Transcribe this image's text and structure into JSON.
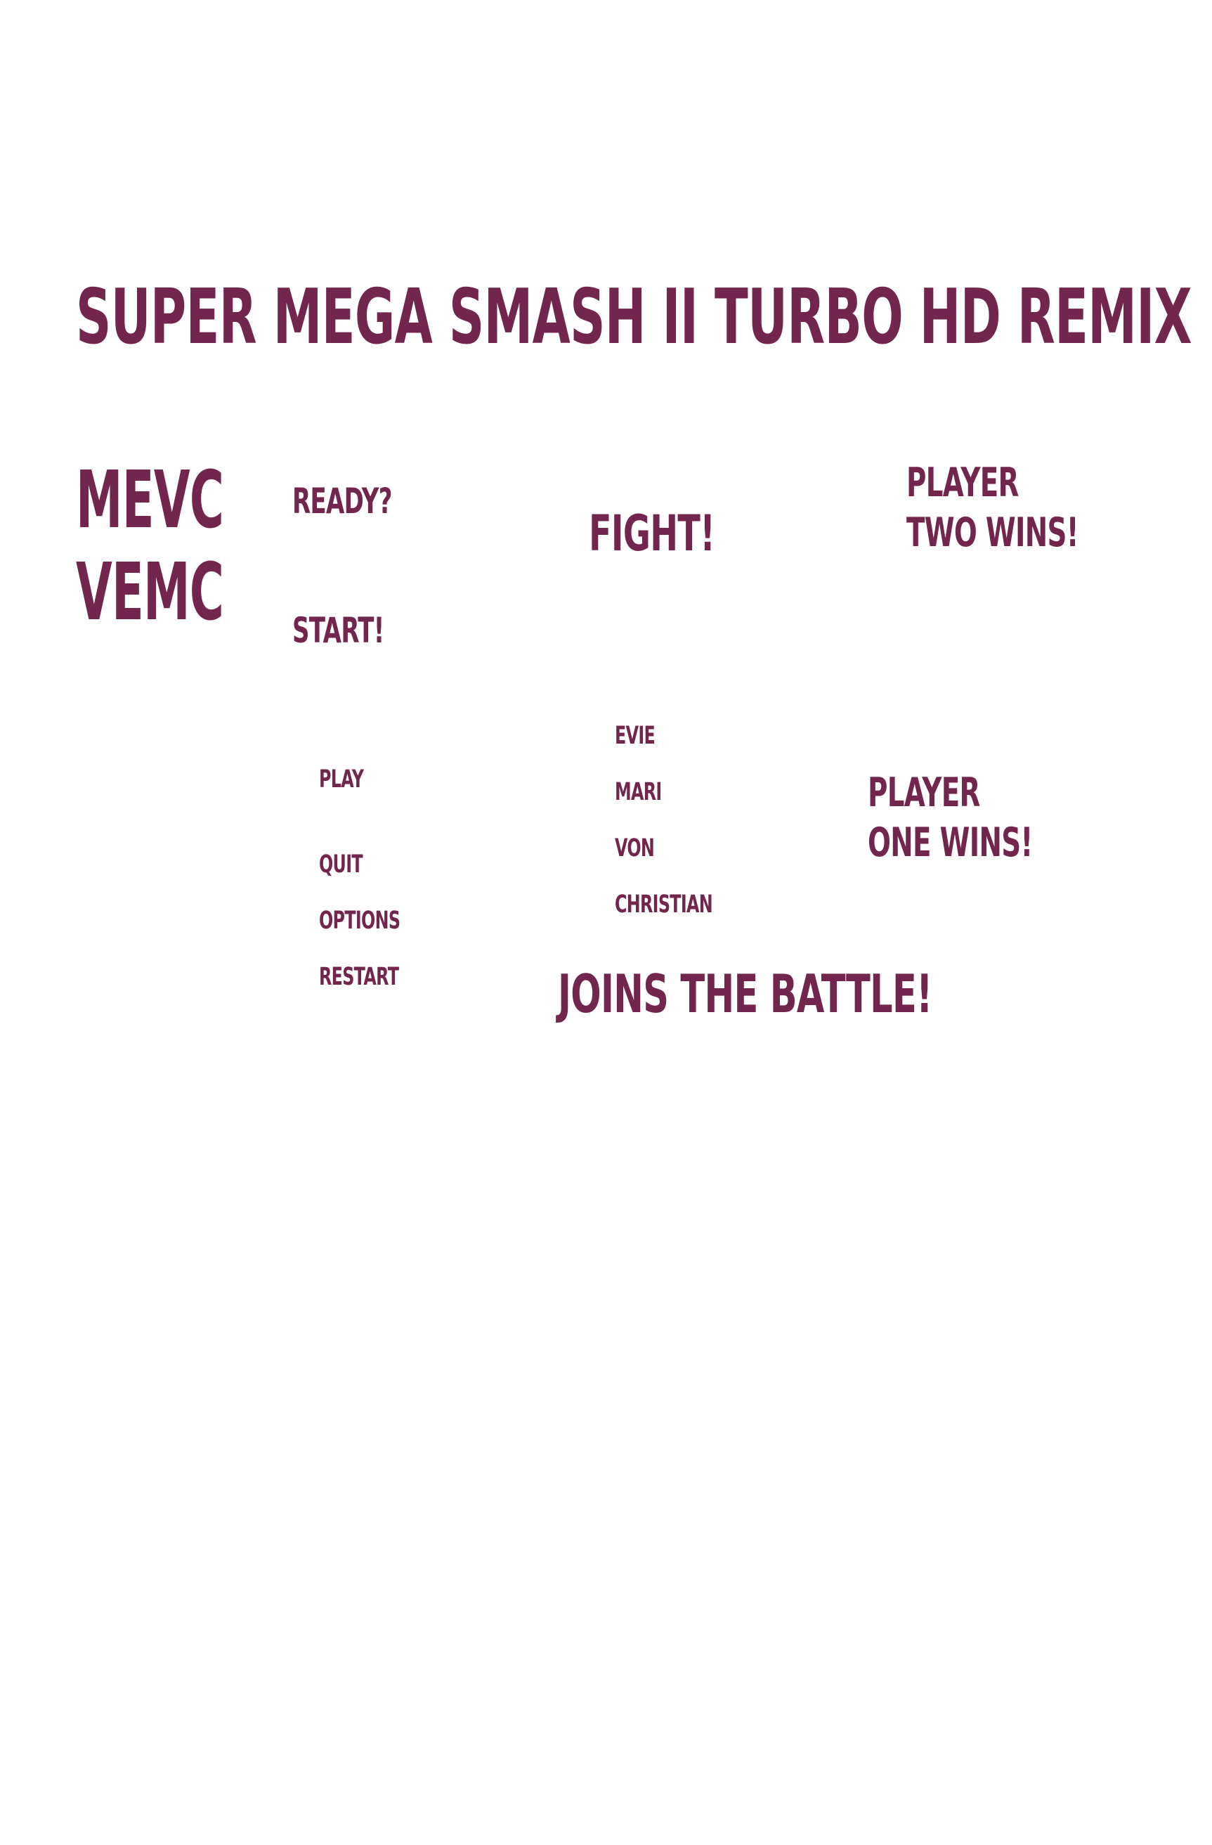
{
  "colors": {
    "text": "#73264d",
    "background": "#ffffff"
  },
  "title": "SUPER MEGA SMASH II TURBO HD REMIX",
  "logo": {
    "line1": "MEVC",
    "line2": "VEMC"
  },
  "announcer": {
    "ready": "READY?",
    "start": "START!",
    "fight": "FIGHT!",
    "player_two_wins": "PLAYER TWO WINS!",
    "player_one_wins": "PLAYER ONE WINS!",
    "joins_the_battle": "JOINS THE BATTLE!"
  },
  "menu": {
    "play": "PLAY",
    "quit": "QUIT",
    "options": "OPTIONS",
    "restart": "RESTART"
  },
  "characters": [
    "EVIE",
    "MARI",
    "VON",
    "CHRISTIAN"
  ]
}
